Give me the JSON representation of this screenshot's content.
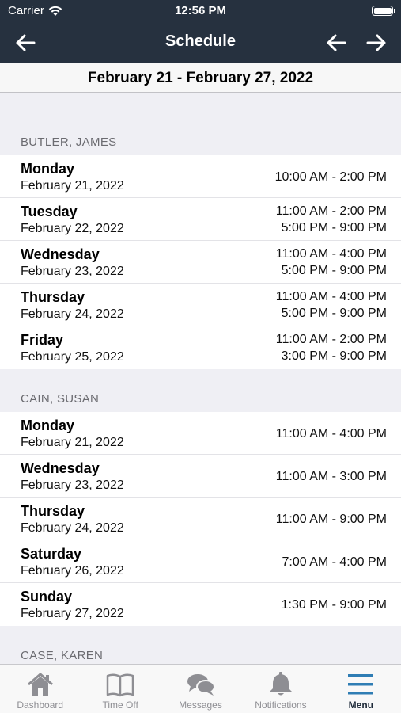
{
  "status": {
    "carrier": "Carrier",
    "time": "12:56 PM"
  },
  "nav": {
    "title": "Schedule"
  },
  "week": {
    "range": "February 21 - February 27, 2022"
  },
  "sections": [
    {
      "name": "BUTLER, JAMES",
      "rows": [
        {
          "day": "Monday",
          "date": "February 21, 2022",
          "times": [
            "10:00 AM - 2:00 PM"
          ]
        },
        {
          "day": "Tuesday",
          "date": "February 22, 2022",
          "times": [
            "11:00 AM - 2:00 PM",
            "5:00 PM - 9:00 PM"
          ]
        },
        {
          "day": "Wednesday",
          "date": "February 23, 2022",
          "times": [
            "11:00 AM - 4:00 PM",
            "5:00 PM - 9:00 PM"
          ]
        },
        {
          "day": "Thursday",
          "date": "February 24, 2022",
          "times": [
            "11:00 AM - 4:00 PM",
            "5:00 PM - 9:00 PM"
          ]
        },
        {
          "day": "Friday",
          "date": "February 25, 2022",
          "times": [
            "11:00 AM - 2:00 PM",
            "3:00 PM - 9:00 PM"
          ]
        }
      ]
    },
    {
      "name": "CAIN, SUSAN",
      "rows": [
        {
          "day": "Monday",
          "date": "February 21, 2022",
          "times": [
            "11:00 AM - 4:00 PM"
          ]
        },
        {
          "day": "Wednesday",
          "date": "February 23, 2022",
          "times": [
            "11:00 AM - 3:00 PM"
          ]
        },
        {
          "day": "Thursday",
          "date": "February 24, 2022",
          "times": [
            "11:00 AM - 9:00 PM"
          ]
        },
        {
          "day": "Saturday",
          "date": "February 26, 2022",
          "times": [
            "7:00 AM - 4:00 PM"
          ]
        },
        {
          "day": "Sunday",
          "date": "February 27, 2022",
          "times": [
            "1:30 PM - 9:00 PM"
          ]
        }
      ]
    },
    {
      "name": "CASE, KAREN",
      "rows": []
    }
  ],
  "tabs": [
    {
      "label": "Dashboard",
      "icon": "home-icon"
    },
    {
      "label": "Time Off",
      "icon": "book-icon"
    },
    {
      "label": "Messages",
      "icon": "chat-bubbles-icon"
    },
    {
      "label": "Notifications",
      "icon": "bell-icon"
    },
    {
      "label": "Menu",
      "icon": "hamburger-menu-icon",
      "active": true
    }
  ],
  "colors": {
    "nav_bg": "#26313f",
    "accent": "#2f7db4",
    "tab_inactive": "#8e8e93"
  }
}
